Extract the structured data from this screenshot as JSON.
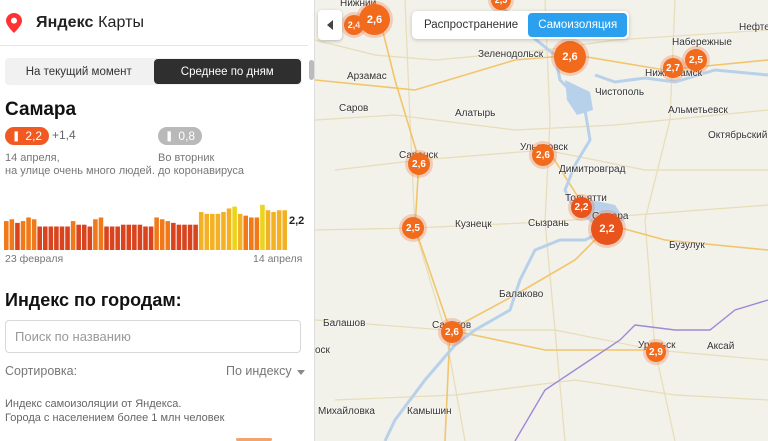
{
  "app": {
    "logo_brand": "Яндекс",
    "logo_product": "Карты"
  },
  "sidebar": {
    "tabs": [
      {
        "label": "На текущий момент",
        "active": false
      },
      {
        "label": "Среднее по дням",
        "active": true
      }
    ],
    "city": "Самара",
    "index_value": "2,2",
    "index_delta": "+1,4",
    "virus_value": "0,8",
    "index_caption_line1": "14 апреля,",
    "index_caption_line2": "на улице очень много людей.",
    "virus_caption_line1": "Во вторник",
    "virus_caption_line2": "до коронавируса",
    "bar_last_label": "2,2",
    "date_start": "23 февраля",
    "date_end": "14 апреля",
    "section_title": "Индекс по городам:",
    "search_placeholder": "Поиск по названию",
    "sort_label": "Сортировка:",
    "sort_value": "По индексу",
    "footer_line1": "Индекс самоизоляции от Яндекса.",
    "footer_line2": "Города с населением более 1 млн человек"
  },
  "daily_bars": {
    "values": [
      1.6,
      1.7,
      1.5,
      1.6,
      1.8,
      1.7,
      1.3,
      1.3,
      1.3,
      1.3,
      1.3,
      1.3,
      1.6,
      1.4,
      1.4,
      1.3,
      1.7,
      1.8,
      1.3,
      1.3,
      1.3,
      1.4,
      1.4,
      1.4,
      1.4,
      1.3,
      1.3,
      1.8,
      1.7,
      1.6,
      1.5,
      1.4,
      1.4,
      1.4,
      1.4,
      2.1,
      2.0,
      2.0,
      2.0,
      2.1,
      2.3,
      2.4,
      2.0,
      1.9,
      1.8,
      1.8,
      2.5,
      2.2,
      2.1,
      2.2,
      2.2
    ],
    "colors": {
      "low": "#d9431e",
      "mid": "#f07a1a",
      "high": "#f3b225",
      "top": "#ebd41a"
    }
  },
  "map": {
    "toggle": [
      {
        "label": "Распространение",
        "active": false
      },
      {
        "label": "Самоизоляция",
        "active": true
      }
    ],
    "cities": [
      "Нижний",
      "Набережные",
      "Нефте",
      "Зеленодольск",
      "Нижнекамск",
      "Арзамас",
      "Чистополь",
      "Альметьевск",
      "Саров",
      "Алатырь",
      "Октябрьский",
      "Саранск",
      "Ульяновск",
      "Димитровград",
      "Тольятти",
      "Самара",
      "Кузнецк",
      "Сызрань",
      "Бузулук",
      "Балаково",
      "Балашов",
      "Саратов",
      "Уральск",
      "Аксай",
      "оск",
      "Михайловка",
      "Камышин"
    ],
    "clusters": [
      "2,4",
      "2,6",
      "2,5",
      "2,6",
      "2,7",
      "2,5",
      "2,6",
      "2,6",
      "2,2",
      "2,2",
      "2,5",
      "2,6",
      "2,9"
    ],
    "cluster_colors": {
      "low": "#f26a1c",
      "high": "#e9531c"
    }
  }
}
